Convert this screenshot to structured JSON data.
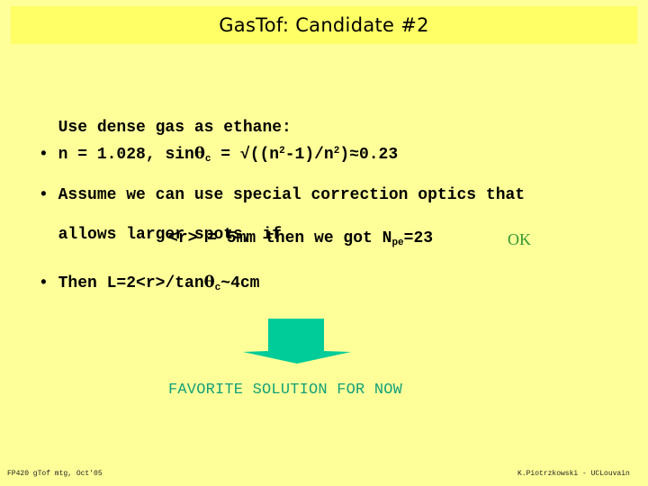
{
  "header": {
    "title": "GasTof: Candidate #2"
  },
  "body": {
    "line1": "Use dense gas as ethane:",
    "line2": {
      "bullet": "•",
      "prefix": "n = 1.028, sin",
      "theta": "θ",
      "theta_sub": "c",
      "eq": " = √((n",
      "sup1": "2",
      "mid": "-1)/n",
      "sup2": "2",
      "suffix": ")≈0.23"
    },
    "line3": {
      "bullet": "•",
      "text": "Assume we can use special correction optics that"
    },
    "line4": "allows larger spots, if",
    "line5": {
      "text": "<r> = 5mm then we got N",
      "sub": "pe",
      "value": "=23",
      "ok": "OK"
    },
    "line6": {
      "bullet": "•",
      "prefix": "Then L=2<r>/tan",
      "theta": "θ",
      "theta_sub": "c",
      "suffix": "~4cm"
    }
  },
  "arrow": {
    "icon": "down-arrow-icon",
    "color": "#00CC99"
  },
  "conclusion": "FAVORITE SOLUTION FOR NOW",
  "footer": {
    "left": "FP420 gTof mtg, Oct'05",
    "right": "K.Piotrzkowski - UCLouvain"
  },
  "colors": {
    "background": "#FFFF99",
    "title_bar": "#FFFF66",
    "ok": "#339933",
    "conclusion": "#14A07A"
  }
}
